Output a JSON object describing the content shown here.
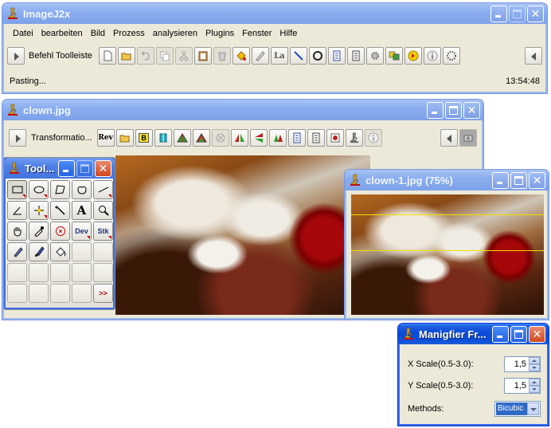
{
  "main_window": {
    "title": "ImageJ2x",
    "menu": [
      "Datei",
      "bearbeiten",
      "Bild",
      "Prozess",
      "analysieren",
      "Plugins",
      "Fenster",
      "Hilfe"
    ],
    "toolbar_label": "Befehl Toolleiste",
    "toolbar_icons": [
      "new-file-icon",
      "open-folder-icon",
      "undo-icon",
      "copy-icon",
      "cut-icon",
      "paste-icon",
      "delete-icon",
      "fill-icon",
      "pen-icon",
      "label-icon",
      "line-icon",
      "circle-icon",
      "document-icon",
      "document-icon",
      "settings-icon",
      "layers-icon",
      "color-icon",
      "info-icon",
      "options-icon"
    ],
    "label_glyph": "La",
    "status_left": "Pasting...",
    "status_right": "13:54:48"
  },
  "clown_window": {
    "title": "clown.jpg",
    "toolbar_label": "Transformatio...",
    "rev_label": "Rev",
    "b_label": "B"
  },
  "tools_window": {
    "title": "Tool...",
    "text_tool_label": "A",
    "dev_label": "Dev",
    "stk_label": "Stk",
    "more_label": ">>"
  },
  "clown1_window": {
    "title": "clown-1.jpg (75%)"
  },
  "magnifier_window": {
    "title": "Manigfier Fr...",
    "x_scale_label": "X Scale(0.5-3.0):",
    "x_scale_value": "1,5",
    "y_scale_label": "Y Scale(0.5-3.0):",
    "y_scale_value": "1,5",
    "methods_label": "Methods:",
    "methods_value": "Bicubic"
  },
  "colors": {
    "title_active": "#0a4ad8",
    "title_inactive": "#7ea2e8",
    "window_bg": "#ece9d8",
    "selection_yellow": "#f0e000"
  }
}
